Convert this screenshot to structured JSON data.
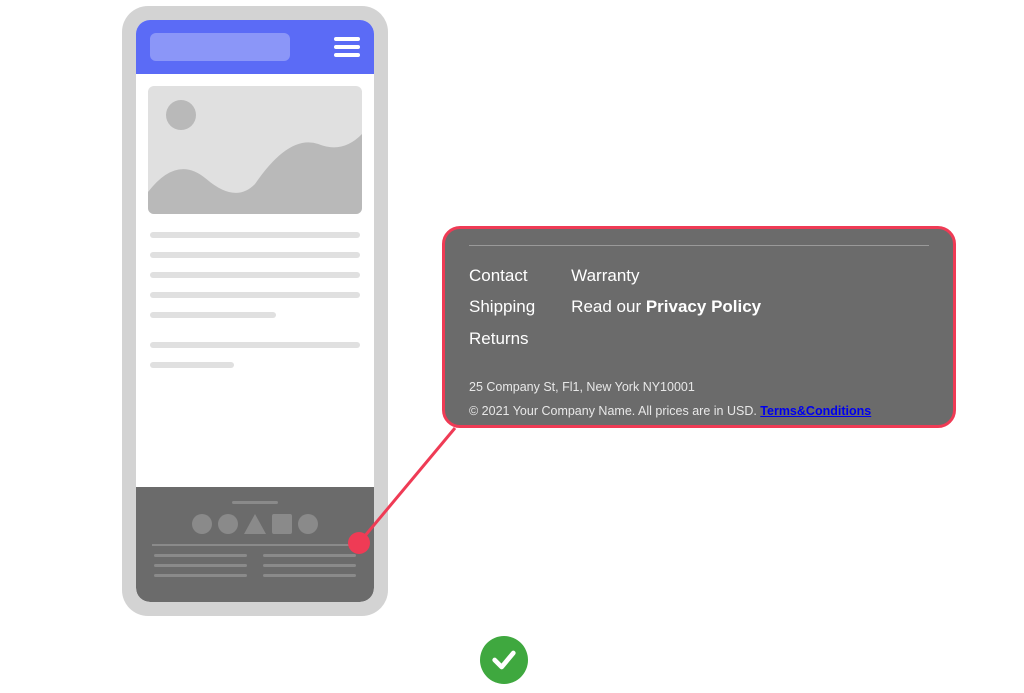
{
  "callout": {
    "links_col1": [
      "Contact",
      "Shipping",
      "Returns"
    ],
    "links_col2_plain": "Warranty",
    "links_col2_prefix": "Read our ",
    "links_col2_link": "Privacy Policy",
    "address": "25 Company St, Fl1, New York NY10001",
    "copyright_prefix": "© 2021 Your Company Name. All prices are in USD. ",
    "terms_label": "Terms&Conditions"
  },
  "colors": {
    "accent_blue": "#5b6bf6",
    "callout_border": "#ef3b55",
    "footer_gray": "#6b6b6b",
    "check_green": "#3fa83f"
  }
}
